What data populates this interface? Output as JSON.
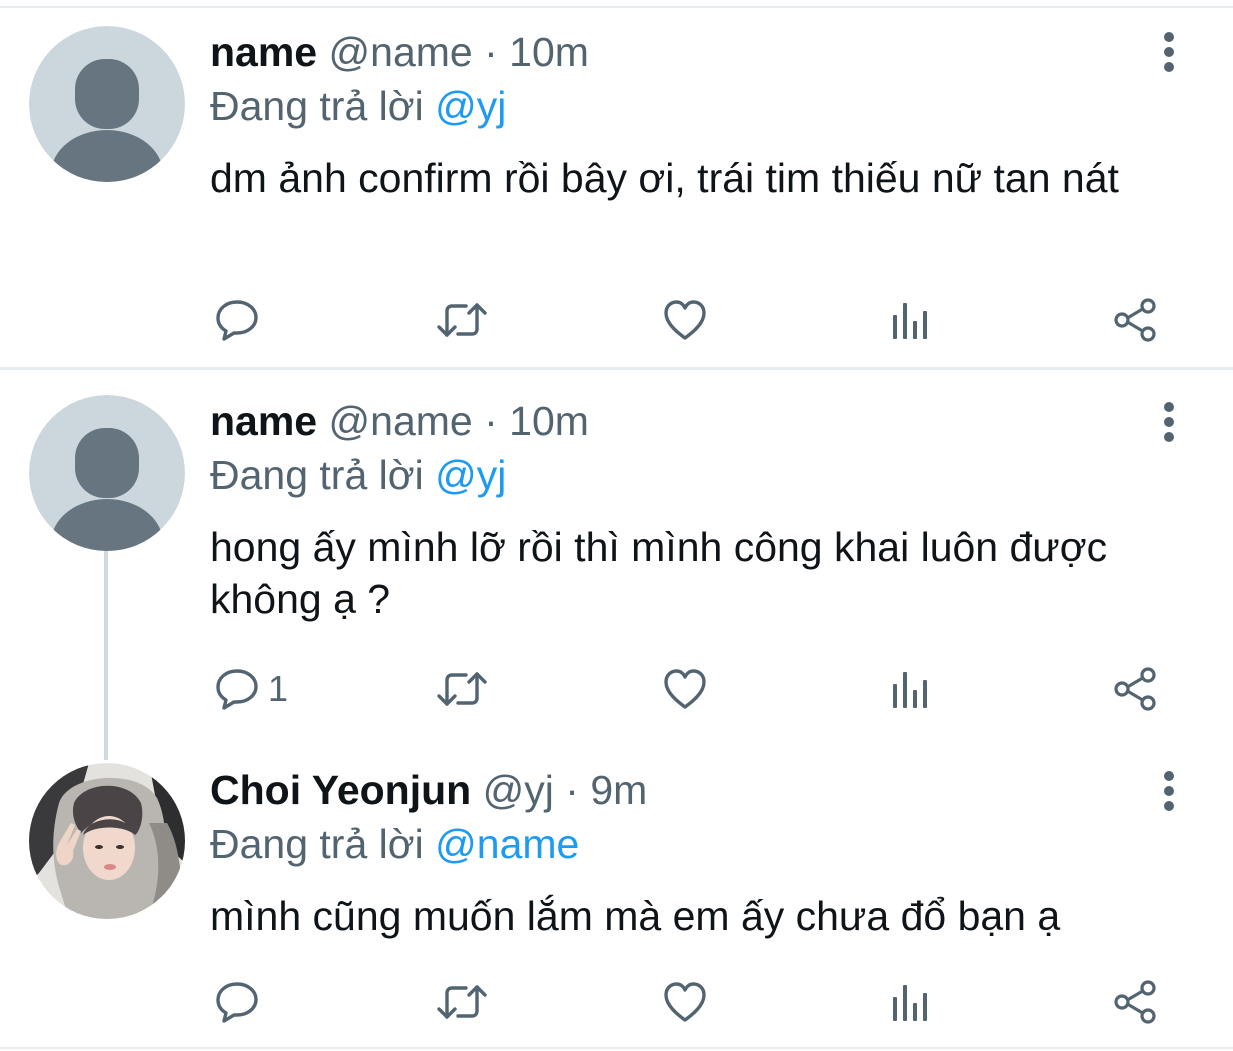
{
  "tweets": [
    {
      "author": "name",
      "handle": "@name",
      "time": "10m",
      "reply_prefix": "Đang trả lời",
      "reply_to": "@yj",
      "text": "dm ảnh confirm rồi bây ơi, trái tim thiếu nữ tan nát",
      "reply_count": "",
      "avatar": "default-avatar"
    },
    {
      "author": "name",
      "handle": "@name",
      "time": "10m",
      "reply_prefix": "Đang trả lời",
      "reply_to": "@yj",
      "text": "hong ấy mình lỡ rồi thì mình công khai luôn được không ạ ?",
      "reply_count": "1",
      "avatar": "default-avatar"
    },
    {
      "author": "Choi Yeonjun",
      "handle": "@yj",
      "time": "9m",
      "reply_prefix": "Đang trả lời",
      "reply_to": "@name",
      "text": "mình cũng muốn lắm mà em ấy chưa đổ bạn ạ",
      "reply_count": "",
      "avatar": "photo-avatar"
    }
  ],
  "separator_dot": "·",
  "icons": {
    "reply": "reply-icon",
    "retweet": "retweet-icon",
    "like": "heart-icon",
    "views": "analytics-icon",
    "share": "share-icon",
    "more": "more-vertical-icon"
  },
  "colors": {
    "text": "#0f1419",
    "secondary": "#536471",
    "link": "#1d9bf0",
    "border": "#e6ecf0",
    "avatar_bg": "#ccd6dd",
    "avatar_fg": "#66757f"
  }
}
